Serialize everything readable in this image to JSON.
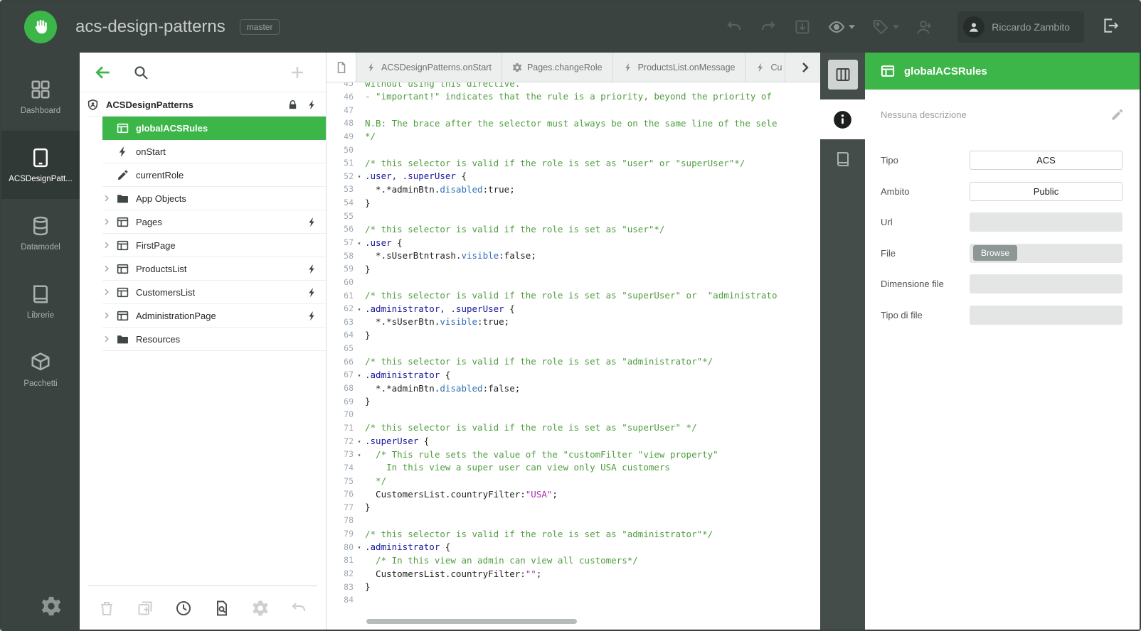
{
  "colors": {
    "accent": "#3cb549",
    "topbar_bg": "#3b4341",
    "code_comment": "#4f9d3f",
    "code_selector": "#16169b",
    "code_property": "#2e6fb7",
    "code_value": "#a62ab2"
  },
  "topbar": {
    "title": "acs-design-patterns",
    "branch": "master",
    "user": "Riccardo Zambito",
    "icons": [
      {
        "icon": "undo-icon",
        "caret": false
      },
      {
        "icon": "redo-icon",
        "caret": false
      },
      {
        "icon": "import-box-icon",
        "caret": false
      },
      {
        "icon": "eye-icon",
        "caret": true,
        "lighter": true
      },
      {
        "icon": "tag-icon",
        "caret": true
      },
      {
        "icon": "add-user-icon",
        "caret": false
      }
    ]
  },
  "sidebar": {
    "items": [
      {
        "label": "Dashboard",
        "icon": "dashboard-icon",
        "active": false
      },
      {
        "label": "ACSDesignPatt...",
        "icon": "device-icon",
        "active": true
      },
      {
        "label": "Datamodel",
        "icon": "database-icon",
        "active": false
      },
      {
        "label": "Librerie",
        "icon": "book-icon",
        "active": false
      },
      {
        "label": "Pacchetti",
        "icon": "package-icon",
        "active": false
      }
    ]
  },
  "tree": {
    "root": {
      "label": "ACSDesignPatterns",
      "icon": "shield-icon",
      "right_icons": [
        "lock-icon",
        "acs-bolt-icon"
      ]
    },
    "items": [
      {
        "label": "globalACSRules",
        "icon": "window-icon",
        "selected": true,
        "chevron": false,
        "badge": false
      },
      {
        "label": "onStart",
        "icon": "bolt-icon",
        "selected": false,
        "chevron": false,
        "badge": false
      },
      {
        "label": "currentRole",
        "icon": "pencil-icon",
        "selected": false,
        "chevron": false,
        "badge": false
      },
      {
        "label": "App Objects",
        "icon": "folder-icon",
        "selected": false,
        "chevron": true,
        "badge": false
      },
      {
        "label": "Pages",
        "icon": "window-icon",
        "selected": false,
        "chevron": true,
        "badge": true
      },
      {
        "label": "FirstPage",
        "icon": "window-icon",
        "selected": false,
        "chevron": true,
        "badge": false
      },
      {
        "label": "ProductsList",
        "icon": "window-icon",
        "selected": false,
        "chevron": true,
        "badge": true
      },
      {
        "label": "CustomersList",
        "icon": "window-icon",
        "selected": false,
        "chevron": true,
        "badge": true
      },
      {
        "label": "AdministrationPage",
        "icon": "window-icon",
        "selected": false,
        "chevron": true,
        "badge": true
      },
      {
        "label": "Resources",
        "icon": "folder-icon",
        "selected": false,
        "chevron": true,
        "badge": false
      }
    ],
    "bottom_icons": [
      {
        "icon": "trash-icon",
        "enabled": false
      },
      {
        "icon": "add-frame-icon",
        "enabled": false
      },
      {
        "icon": "history-icon",
        "enabled": true
      },
      {
        "icon": "search-doc-icon",
        "enabled": true
      },
      {
        "icon": "gear-icon",
        "enabled": false
      },
      {
        "icon": "undo-icon",
        "enabled": false
      }
    ]
  },
  "editor": {
    "tabs": [
      {
        "label": "ACSDesignPatterns.onStart",
        "icon": "bolt-icon",
        "cut": false
      },
      {
        "label": "Pages.changeRole",
        "icon": "gear-icon",
        "cut": false
      },
      {
        "label": "ProductsList.onMessage",
        "icon": "bolt-icon",
        "cut": false
      },
      {
        "label": "Cu",
        "icon": "bolt-icon",
        "cut": true
      }
    ],
    "first_line": 45,
    "lines": [
      {
        "n": 45,
        "fold": false,
        "t": [
          [
            "cm",
            "without using this directive."
          ]
        ]
      },
      {
        "n": 46,
        "fold": false,
        "t": [
          [
            "cm",
            "- \"important!\" indicates that the rule is a priority, beyond the priority of"
          ]
        ]
      },
      {
        "n": 47,
        "fold": false,
        "t": []
      },
      {
        "n": 48,
        "fold": false,
        "t": [
          [
            "cm",
            "N.B: The brace after the selector must always be on the same line of the sele"
          ]
        ]
      },
      {
        "n": 49,
        "fold": false,
        "t": [
          [
            "cm",
            "*/"
          ]
        ]
      },
      {
        "n": 50,
        "fold": false,
        "t": []
      },
      {
        "n": 51,
        "fold": false,
        "t": [
          [
            "cm",
            "/* this selector is valid if the role is set as \"user\" or \"superUser\"*/"
          ]
        ]
      },
      {
        "n": 52,
        "fold": true,
        "t": [
          [
            "sel",
            ".user, .superUser"
          ],
          [
            "plain",
            " {"
          ]
        ]
      },
      {
        "n": 53,
        "fold": false,
        "t": [
          [
            "plain",
            "  *.*adminBtn."
          ],
          [
            "prop",
            "disabled"
          ],
          [
            "plain",
            ":true;"
          ]
        ]
      },
      {
        "n": 54,
        "fold": false,
        "t": [
          [
            "plain",
            "}"
          ]
        ]
      },
      {
        "n": 55,
        "fold": false,
        "t": []
      },
      {
        "n": 56,
        "fold": false,
        "t": [
          [
            "cm",
            "/* this selector is valid if the role is set as \"user\"*/"
          ]
        ]
      },
      {
        "n": 57,
        "fold": true,
        "t": [
          [
            "sel",
            ".user"
          ],
          [
            "plain",
            " {"
          ]
        ]
      },
      {
        "n": 58,
        "fold": false,
        "t": [
          [
            "plain",
            "  *.sUserBtntrash."
          ],
          [
            "prop",
            "visible"
          ],
          [
            "plain",
            ":false;"
          ]
        ]
      },
      {
        "n": 59,
        "fold": false,
        "t": [
          [
            "plain",
            "}"
          ]
        ]
      },
      {
        "n": 60,
        "fold": false,
        "t": []
      },
      {
        "n": 61,
        "fold": false,
        "t": [
          [
            "cm",
            "/* this selector is valid if the role is set as \"superUser\" or  \"administrato"
          ]
        ]
      },
      {
        "n": 62,
        "fold": true,
        "t": [
          [
            "sel",
            ".administrator, .superUser"
          ],
          [
            "plain",
            " {"
          ]
        ]
      },
      {
        "n": 63,
        "fold": false,
        "t": [
          [
            "plain",
            "  *.*sUserBtn."
          ],
          [
            "prop",
            "visible"
          ],
          [
            "plain",
            ":true;"
          ]
        ]
      },
      {
        "n": 64,
        "fold": false,
        "t": [
          [
            "plain",
            "}"
          ]
        ]
      },
      {
        "n": 65,
        "fold": false,
        "t": []
      },
      {
        "n": 66,
        "fold": false,
        "t": [
          [
            "cm",
            "/* this selector is valid if the role is set as \"administrator\"*/"
          ]
        ]
      },
      {
        "n": 67,
        "fold": true,
        "t": [
          [
            "sel",
            ".administrator"
          ],
          [
            "plain",
            " {"
          ]
        ]
      },
      {
        "n": 68,
        "fold": false,
        "t": [
          [
            "plain",
            "  *.*adminBtn."
          ],
          [
            "prop",
            "disabled"
          ],
          [
            "plain",
            ":false;"
          ]
        ]
      },
      {
        "n": 69,
        "fold": false,
        "t": [
          [
            "plain",
            "}"
          ]
        ]
      },
      {
        "n": 70,
        "fold": false,
        "t": []
      },
      {
        "n": 71,
        "fold": false,
        "t": [
          [
            "cm",
            "/* this selector is valid if the role is set as \"superUser\" */"
          ]
        ]
      },
      {
        "n": 72,
        "fold": true,
        "t": [
          [
            "sel",
            ".superUser"
          ],
          [
            "plain",
            " {"
          ]
        ]
      },
      {
        "n": 73,
        "fold": true,
        "t": [
          [
            "cm",
            "  /* This rule sets the value of the \"customFilter \"view property\""
          ]
        ]
      },
      {
        "n": 74,
        "fold": false,
        "t": [
          [
            "cm",
            "    In this view a super user can view only USA customers"
          ]
        ]
      },
      {
        "n": 75,
        "fold": false,
        "t": [
          [
            "cm",
            "  */"
          ]
        ]
      },
      {
        "n": 76,
        "fold": false,
        "t": [
          [
            "plain",
            "  CustomersList.countryFilter:"
          ],
          [
            "val",
            "\"USA\""
          ],
          [
            "plain",
            ";"
          ]
        ]
      },
      {
        "n": 77,
        "fold": false,
        "t": [
          [
            "plain",
            "}"
          ]
        ]
      },
      {
        "n": 78,
        "fold": false,
        "t": []
      },
      {
        "n": 79,
        "fold": false,
        "t": [
          [
            "cm",
            "/* this selector is valid if the role is set as \"administrator\"*/"
          ]
        ]
      },
      {
        "n": 80,
        "fold": true,
        "t": [
          [
            "sel",
            ".administrator"
          ],
          [
            "plain",
            " {"
          ]
        ]
      },
      {
        "n": 81,
        "fold": false,
        "t": [
          [
            "cm",
            "  /* In this view an admin can view all customers*/"
          ]
        ]
      },
      {
        "n": 82,
        "fold": false,
        "t": [
          [
            "plain",
            "  CustomersList.countryFilter:"
          ],
          [
            "val",
            "\"\""
          ],
          [
            "plain",
            ";"
          ]
        ]
      },
      {
        "n": 83,
        "fold": false,
        "t": [
          [
            "plain",
            "}"
          ]
        ]
      },
      {
        "n": 84,
        "fold": false,
        "t": []
      }
    ]
  },
  "strip": {
    "tabs": [
      {
        "icon": "columns-icon",
        "style": "button"
      },
      {
        "icon": "info-icon",
        "active": true
      },
      {
        "icon": "book-icon",
        "active": false
      }
    ]
  },
  "properties": {
    "title": "globalACSRules",
    "description": "Nessuna descrizione",
    "fields": [
      {
        "label": "Tipo",
        "value": "ACS",
        "kind": "white"
      },
      {
        "label": "Ambito",
        "value": "Public",
        "kind": "white"
      },
      {
        "label": "Url",
        "value": "",
        "kind": "gray"
      },
      {
        "label": "File",
        "value": "",
        "kind": "file",
        "button": "Browse"
      },
      {
        "label": "Dimensione file",
        "value": "",
        "kind": "gray"
      },
      {
        "label": "Tipo di file",
        "value": "",
        "kind": "gray"
      }
    ]
  }
}
